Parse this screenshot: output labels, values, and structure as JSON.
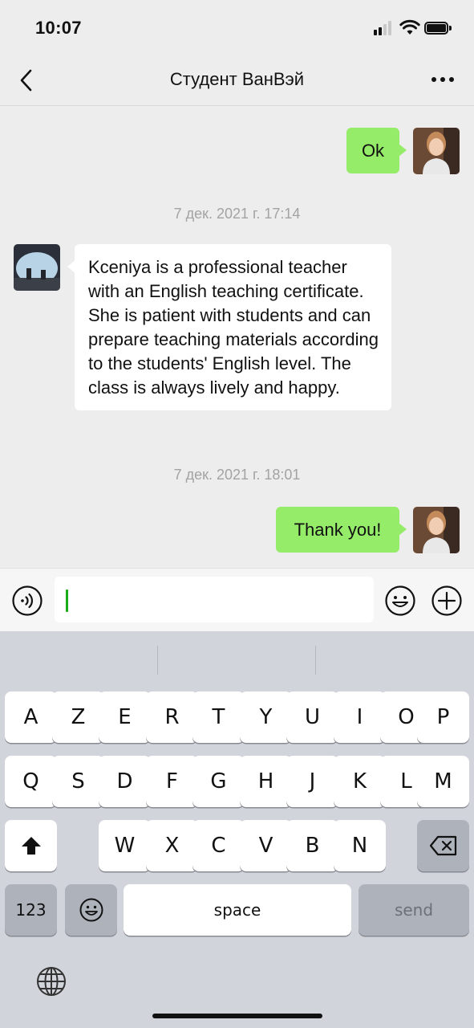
{
  "status_bar": {
    "time": "10:07"
  },
  "nav": {
    "title": "Студент ВанВэй"
  },
  "messages": [
    {
      "type": "outgoing",
      "text": "Ok"
    },
    {
      "type": "timestamp",
      "text": "7 дек. 2021 г. 17:14"
    },
    {
      "type": "incoming",
      "text": "Kceniya is a professional teacher with an English teaching certificate. She is patient with students and can prepare teaching materials according to the students' English level. The class is always lively and happy."
    },
    {
      "type": "timestamp",
      "text": "7 дек. 2021 г. 18:01"
    },
    {
      "type": "outgoing",
      "text": "Thank you!"
    }
  ],
  "input": {
    "value": ""
  },
  "keyboard": {
    "row1": [
      "A",
      "Z",
      "E",
      "R",
      "T",
      "Y",
      "U",
      "I",
      "O",
      "P"
    ],
    "row2": [
      "Q",
      "S",
      "D",
      "F",
      "G",
      "H",
      "J",
      "K",
      "L",
      "M"
    ],
    "row3": [
      "W",
      "X",
      "C",
      "V",
      "B",
      "N"
    ],
    "numbers_label": "123",
    "space_label": "space",
    "send_label": "send"
  },
  "colors": {
    "outgoing_bubble": "#95ec69",
    "incoming_bubble": "#ffffff",
    "cursor": "#1aad19",
    "background": "#ededed"
  },
  "icons": [
    "back-chevron-icon",
    "more-dots-icon",
    "voice-icon",
    "emoji-icon",
    "plus-icon",
    "shift-icon",
    "backspace-icon",
    "globe-icon"
  ]
}
